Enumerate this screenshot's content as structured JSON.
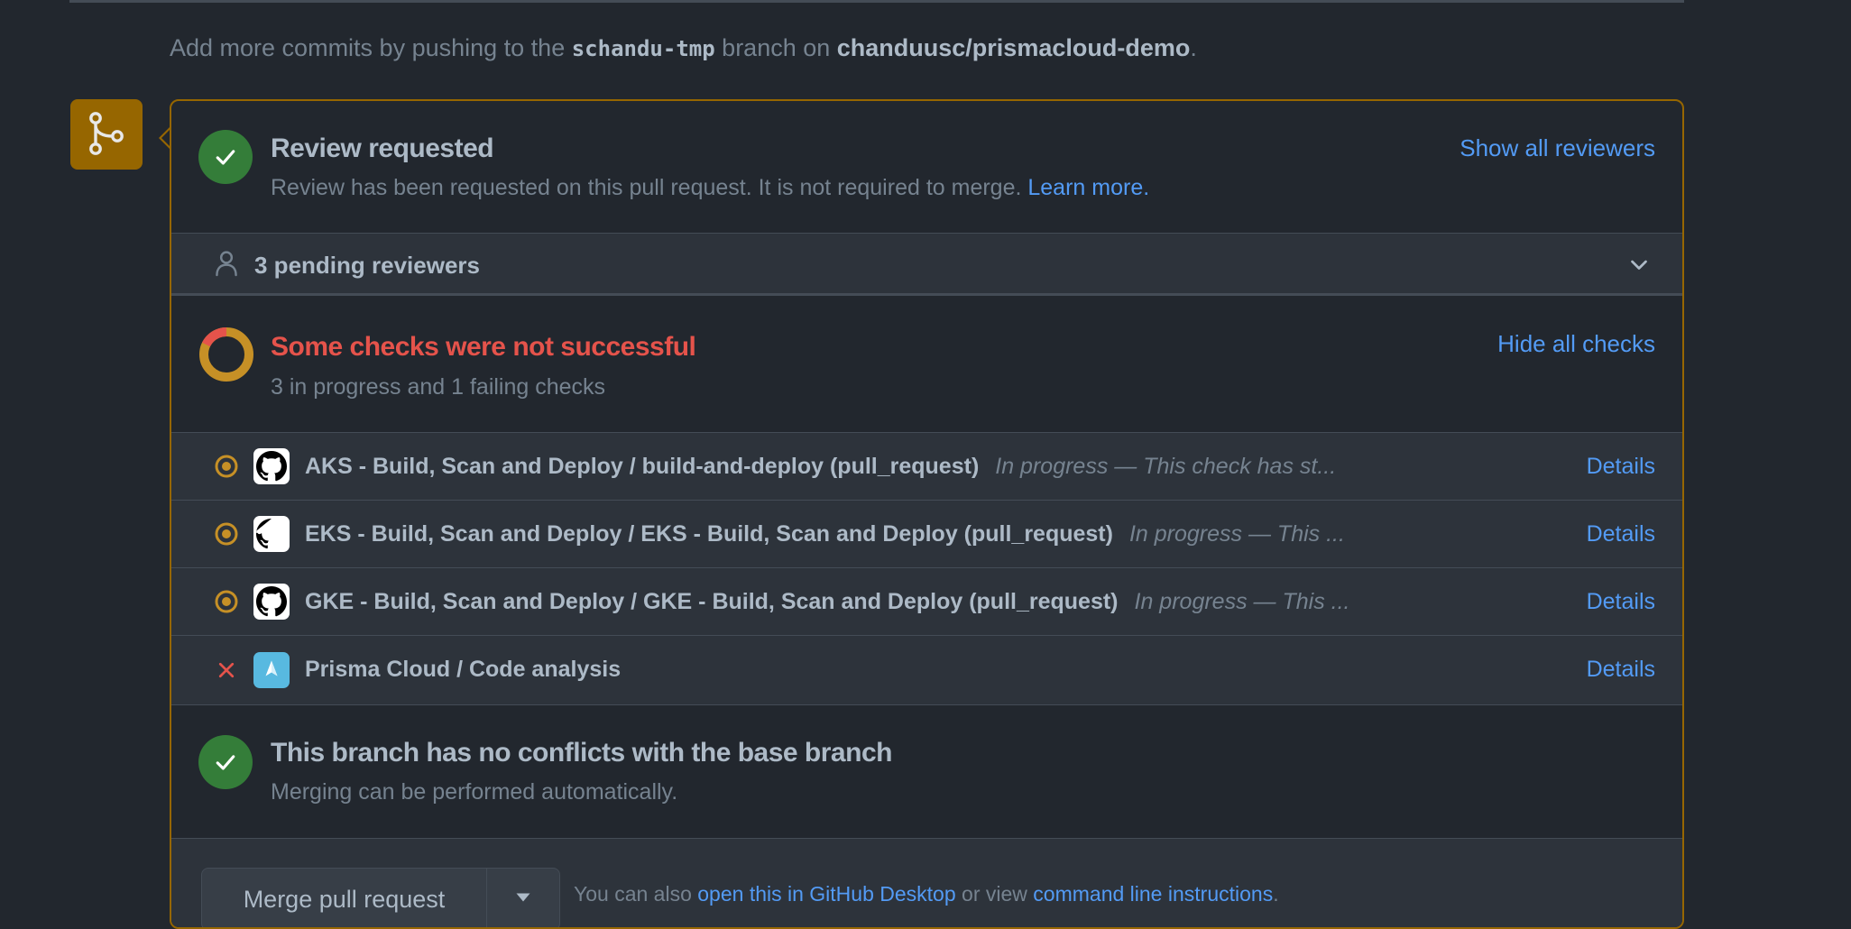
{
  "hint": {
    "prefix": "Add more commits by pushing to the ",
    "branch": "schandu-tmp",
    "middle": " branch on ",
    "repo": "chanduusc/prismacloud-demo",
    "suffix": "."
  },
  "colors": {
    "background": "#22272e",
    "attention": "#966600",
    "success": "#347d39",
    "danger": "#e5534b",
    "link": "#539bf5"
  },
  "review": {
    "title": "Review requested",
    "subtitle": "Review has been requested on this pull request. It is not required to merge.",
    "learn_more": "Learn more.",
    "show_all": "Show all reviewers"
  },
  "pending": {
    "label": "3 pending reviewers"
  },
  "checks": {
    "title": "Some checks were not successful",
    "subtitle": "3 in progress and 1 failing checks",
    "hide_all": "Hide all checks",
    "items": [
      {
        "name": "AKS - Build, Scan and Deploy / build-and-deploy (pull_request)",
        "description": "In progress — This check has st...",
        "status": "in-progress",
        "details": "Details"
      },
      {
        "name": "EKS - Build, Scan and Deploy / EKS - Build, Scan and Deploy (pull_request)",
        "description": "In progress — This ...",
        "status": "in-progress",
        "details": "Details"
      },
      {
        "name": "GKE - Build, Scan and Deploy / GKE - Build, Scan and Deploy (pull_request)",
        "description": "In progress — This ...",
        "status": "in-progress",
        "details": "Details"
      },
      {
        "name": "Prisma Cloud / Code analysis",
        "description": "",
        "status": "failed",
        "details": "Details"
      }
    ]
  },
  "conflicts": {
    "title": "This branch has no conflicts with the base branch",
    "subtitle": "Merging can be performed automatically."
  },
  "merge": {
    "button": "Merge pull request",
    "alt_prefix": "You can also ",
    "alt_link1": "open this in GitHub Desktop",
    "alt_middle": " or view ",
    "alt_link2": "command line instructions",
    "alt_suffix": "."
  }
}
